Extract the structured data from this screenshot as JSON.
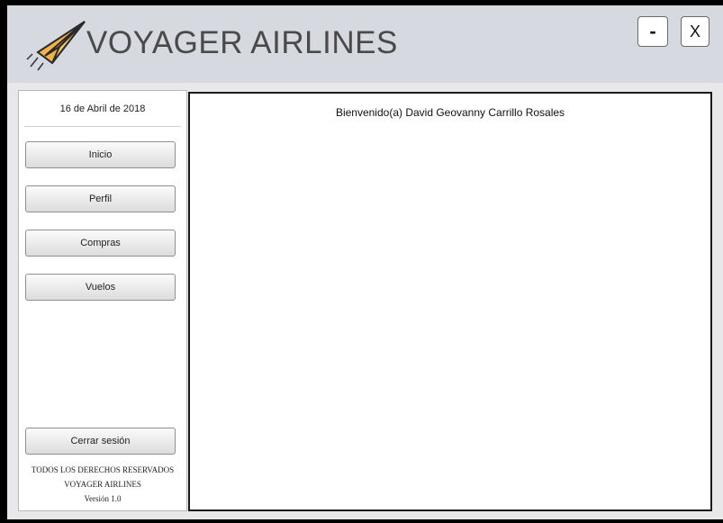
{
  "app": {
    "title": "VOYAGER AIRLINES",
    "logo_icon": "paper-plane-icon"
  },
  "window_controls": {
    "minimize_label": "-",
    "close_label": "X"
  },
  "sidebar": {
    "date": "16 de Abril de 2018",
    "nav": [
      {
        "label": "Inicio"
      },
      {
        "label": "Perfil"
      },
      {
        "label": "Compras"
      },
      {
        "label": "Vuelos"
      }
    ],
    "logout_label": "Cerrar sesión",
    "footer": {
      "rights": "TODOS LOS DERECHOS RESERVADOS",
      "company": "VOYAGER AIRLINES",
      "version": "Versión 1.0"
    }
  },
  "main": {
    "welcome": "Bienvenido(a) David Geovanny Carrillo Rosales"
  },
  "colors": {
    "header_bg": "#d6d9e0",
    "body_bg": "#e8e8ea",
    "plane_fill": "#f3b24a",
    "title_color": "#4a4a4a"
  }
}
